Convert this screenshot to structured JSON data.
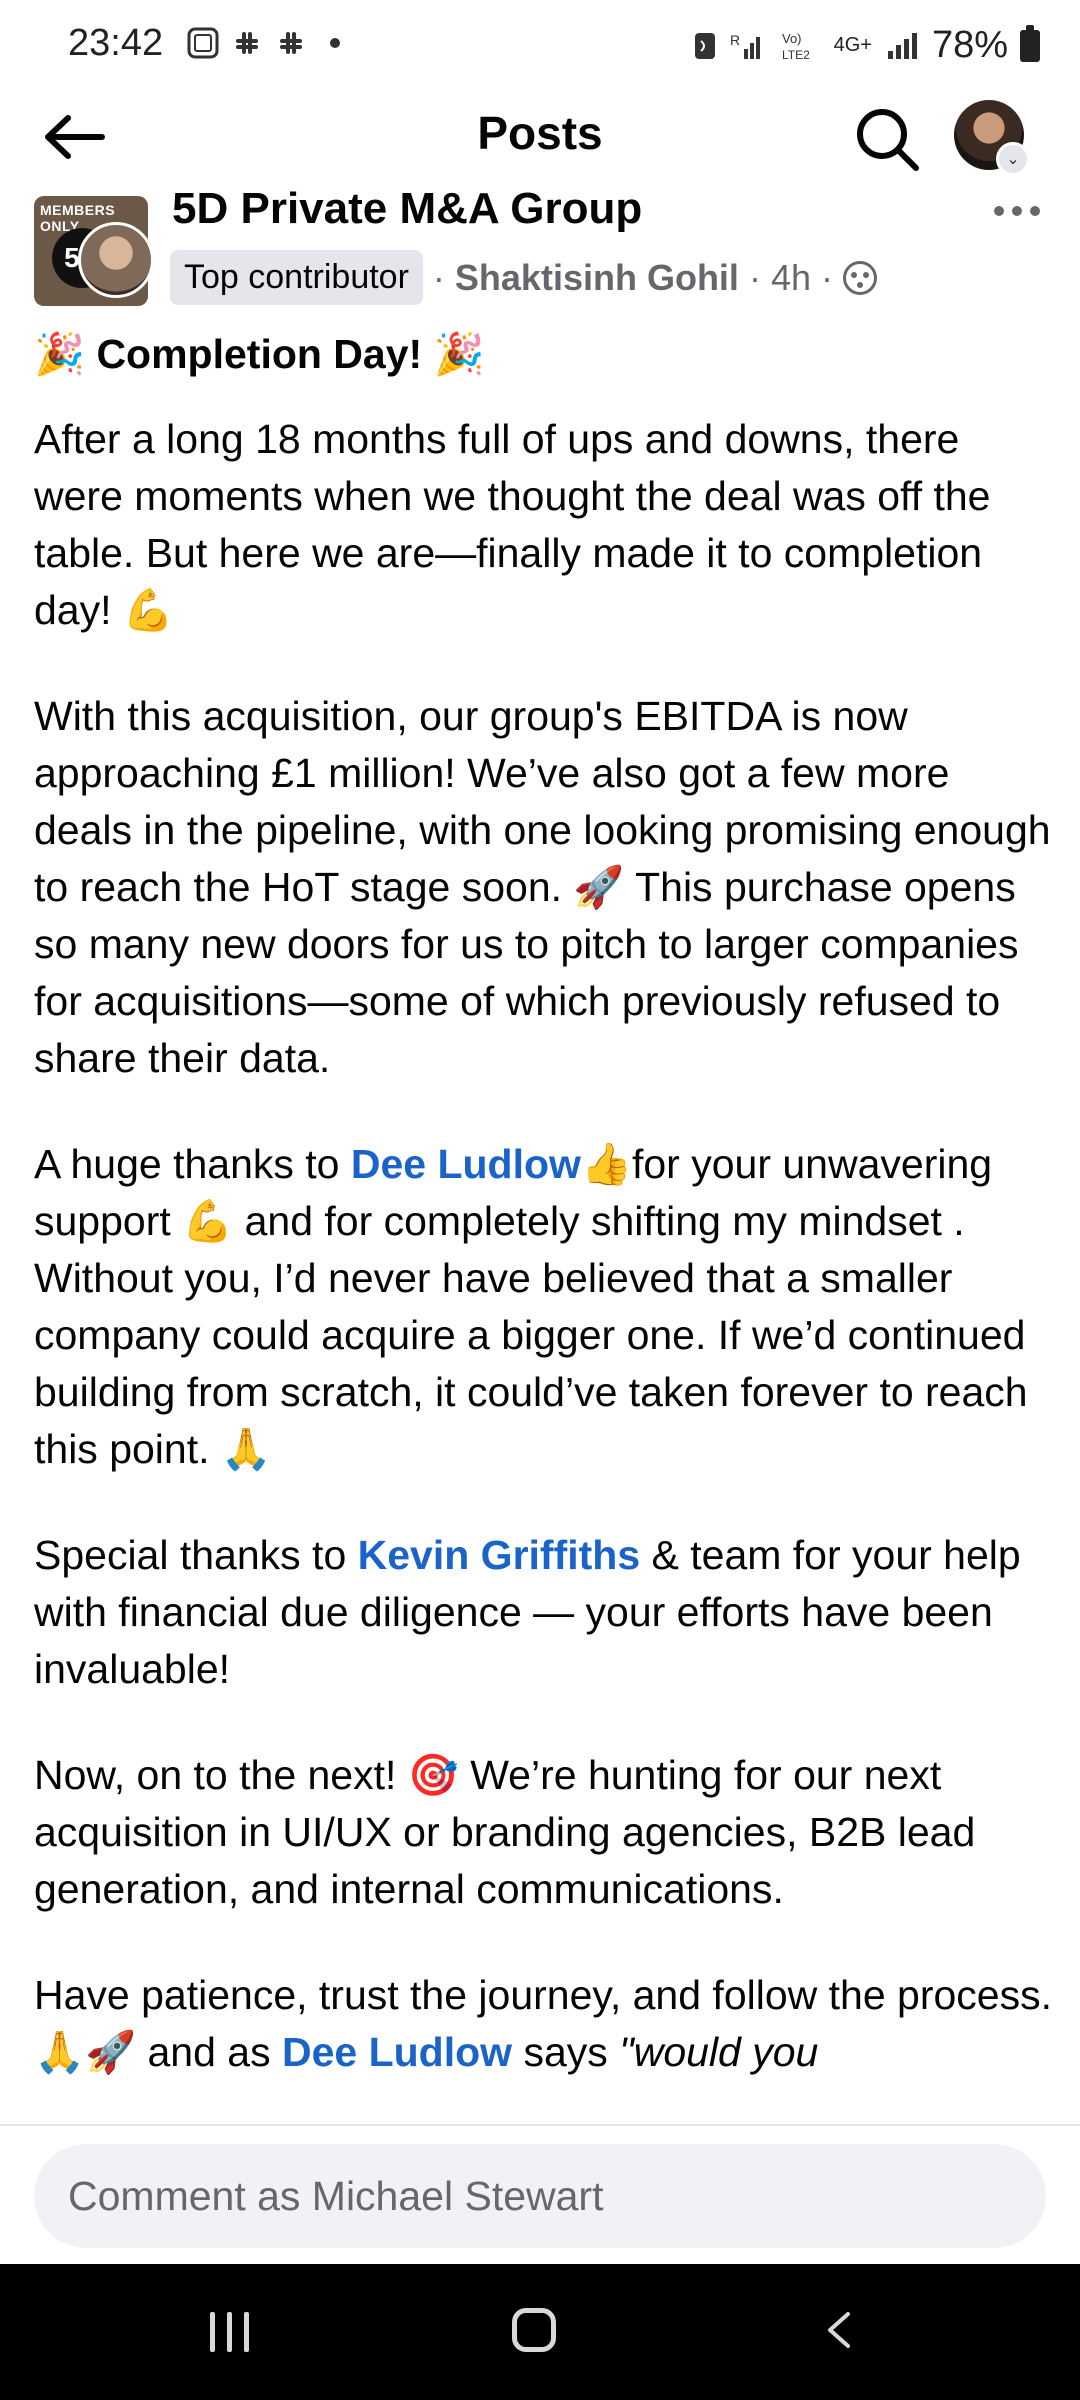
{
  "status_bar": {
    "time": "23:42",
    "battery": "78%",
    "network": "4G+"
  },
  "header": {
    "title": "Posts"
  },
  "post": {
    "group_name": "5D Private M&A Group",
    "group_thumb_text": "MEMBERS ONLY",
    "group_thumb_logo": "5D",
    "badge": "Top contributor",
    "author": "Shaktisinh Gohil",
    "time": "4h",
    "separator": "·",
    "heading": "🎉 Completion Day! 🎉",
    "p1": "After a long 18 months full of ups and downs, there were moments when we thought the deal was off the table. But here we are—finally made it to completion day! 💪",
    "p2": "With this acquisition, our group's EBITDA is now approaching £1 million! We’ve also got a few more deals in the pipeline, with one looking promising enough to reach the HoT stage soon. 🚀 This purchase opens so many new doors for us to pitch to larger companies for acquisitions—some of which previously refused to share their data.",
    "p3_before": "A huge thanks to ",
    "p3_link": "Dee Ludlow",
    "p3_after": "👍for your unwavering support 💪 and for completely shifting my mindset . Without you, I’d never have believed that a smaller company could acquire a bigger one. If we’d continued building from scratch, it could’ve taken forever to reach this point. 🙏",
    "p4_before": "Special thanks to ",
    "p4_link": "Kevin Griffiths",
    "p4_after": " & team for your help with financial due diligence — your efforts have been invaluable!",
    "p5": "Now, on to the next! 🎯 We’re hunting for our next acquisition in UI/UX or branding agencies, B2B lead generation, and internal communications.",
    "p6_before": "Have patience, trust the journey, and follow the process. 🙏🚀 and as ",
    "p6_link": "Dee Ludlow",
    "p6_after_plain": " says ",
    "p6_italic": "\"would you"
  },
  "comment": {
    "placeholder": "Comment as Michael Stewart"
  }
}
